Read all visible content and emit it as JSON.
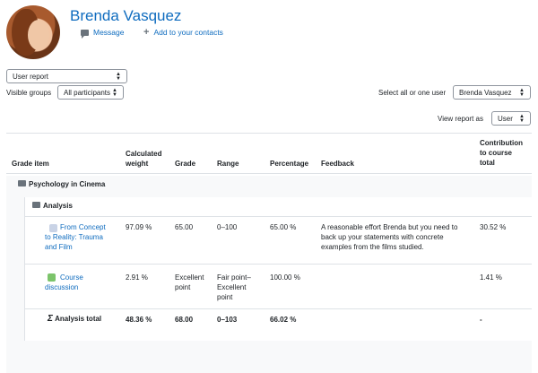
{
  "user": {
    "name": "Brenda Vasquez",
    "message_label": "Message",
    "add_contact_label": "Add to your contacts"
  },
  "controls": {
    "report_select": "User report",
    "visible_groups_label": "Visible groups",
    "groups_select": "All participants",
    "select_user_label": "Select all or one user",
    "user_select": "Brenda Vasquez",
    "view_report_label": "View report as",
    "view_as_select": "User"
  },
  "table": {
    "headers": {
      "grade_item": "Grade item",
      "weight": [
        "Calculated",
        "weight"
      ],
      "grade": "Grade",
      "range": "Range",
      "percentage": "Percentage",
      "feedback": "Feedback",
      "contribution": [
        "Contribution",
        "to course",
        "total"
      ]
    },
    "category": "Psychology in Cinema",
    "subcategory": "Analysis",
    "rows": [
      {
        "item": [
          "From Concept",
          "to Reality: Trauma",
          "and Film"
        ],
        "weight": "97.09 %",
        "grade": "65.00",
        "range": "0–100",
        "percentage": "65.00 %",
        "feedback": [
          "A reasonable effort Brenda but you need to",
          "back up your statements with concrete",
          "examples from the films studied."
        ],
        "contribution": "30.52 %"
      },
      {
        "item": [
          "Course",
          "discussion"
        ],
        "weight": "2.91 %",
        "grade": [
          "Excellent",
          "point"
        ],
        "range": [
          "Fair point–",
          "Excellent",
          "point"
        ],
        "percentage": "100.00 %",
        "feedback": [],
        "contribution": "1.41 %"
      }
    ],
    "total": {
      "label": "Analysis total",
      "weight": "48.36 %",
      "grade": "68.00",
      "range": "0–103",
      "percentage": "66.02 %",
      "contribution": "-"
    }
  }
}
